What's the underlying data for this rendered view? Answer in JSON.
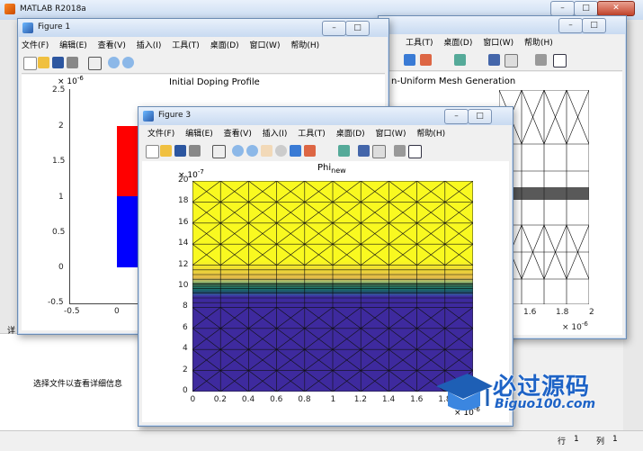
{
  "app": {
    "title": "MATLAB R2018a"
  },
  "left_panel": {
    "detail_text": "选择文件以查看详细信息",
    "collapsed_label": "详"
  },
  "status": {
    "row_label": "行",
    "row_value": "1",
    "col_label": "列",
    "col_value": "1"
  },
  "menu": [
    "文件(F)",
    "编辑(E)",
    "查看(V)",
    "插入(I)",
    "工具(T)",
    "桌面(D)",
    "窗口(W)",
    "帮助(H)"
  ],
  "figure1": {
    "title": "Figure 1",
    "plot_title": "Initial Doping Profile",
    "y_exponent": "× 10",
    "y_exp_power": "-6",
    "y_ticks": [
      "2.5",
      "2",
      "1.5",
      "1",
      "0.5",
      "0",
      "-0.5"
    ],
    "x_ticks": [
      "-0.5",
      "0"
    ]
  },
  "figure2": {
    "menu_visible": [
      "工具(T)",
      "桌面(D)",
      "窗口(W)",
      "帮助(H)"
    ],
    "plot_title": "n-Uniform Mesh Generation",
    "x_ticks": [
      "1.6",
      "1.8",
      "2"
    ],
    "x_exponent": "× 10",
    "x_exp_power": "-6"
  },
  "figure3": {
    "title": "Figure 3",
    "plot_title_main": "Phi",
    "plot_title_sub": "new",
    "y_exponent": "× 10",
    "y_exp_power": "-7",
    "y_ticks": [
      "20",
      "18",
      "16",
      "14",
      "12",
      "10",
      "8",
      "6",
      "4",
      "2",
      "0"
    ],
    "x_ticks": [
      "0",
      "0.2",
      "0.4",
      "0.6",
      "0.8",
      "1",
      "1.2",
      "1.4",
      "1.6",
      "1.8",
      "2"
    ],
    "x_exponent": "× 10",
    "x_exp_power": "-6"
  },
  "watermark": {
    "brand": "必过源码",
    "site": "Biguo100.com"
  },
  "colors": {
    "yellow": "#f9f920",
    "blue": "#3e2a9e",
    "red": "#ff0000",
    "mesh_blue": "#0000ff"
  }
}
